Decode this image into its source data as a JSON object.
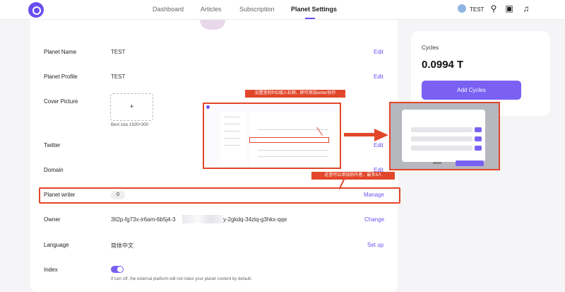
{
  "nav": {
    "tabs": [
      {
        "label": "Dashboard"
      },
      {
        "label": "Articles"
      },
      {
        "label": "Subscription"
      },
      {
        "label": "Planet Settings"
      }
    ],
    "user": "TEST",
    "icons": [
      "logo-icon",
      "person-icon",
      "wallet-icon",
      "bell-icon"
    ]
  },
  "settings": {
    "planet_name": {
      "label": "Planet Name",
      "value": "TEST",
      "action": "Edit"
    },
    "planet_profile": {
      "label": "Planet Profile",
      "value": "TEST",
      "action": "Edit"
    },
    "cover_picture": {
      "label": "Cover Picture",
      "plus": "+",
      "hint": "Best size 1920×300"
    },
    "twitter": {
      "label": "Twitter",
      "action": "Edit"
    },
    "domain": {
      "label": "Domain",
      "action": "Edit"
    },
    "planet_writer": {
      "label": "Planet writer",
      "count": "0",
      "action": "Manage"
    },
    "owner": {
      "label": "Owner",
      "value_start": "3lt2p-fg73x-ir6am-6b5j4-3",
      "value_end": "y-2gkdq-34zlq-g3hkx-qqe",
      "action": "Change"
    },
    "language": {
      "label": "Language",
      "value": "简体中文",
      "action": "Set up"
    },
    "index": {
      "label": "Index",
      "hint": "If turn off, the external platform will not index your planet content by default.",
      "enabled": true
    }
  },
  "cycles": {
    "label": "Cycles",
    "value": "0.0994 T",
    "button": "Add Cycles"
  },
  "annotations": {
    "step1": "设置里的PID填入右侧，即可添加writer协作",
    "step2": "这里可以添加协作者，最多3人"
  },
  "colors": {
    "accent": "#7a61f3",
    "annotation": "#e2472b"
  }
}
